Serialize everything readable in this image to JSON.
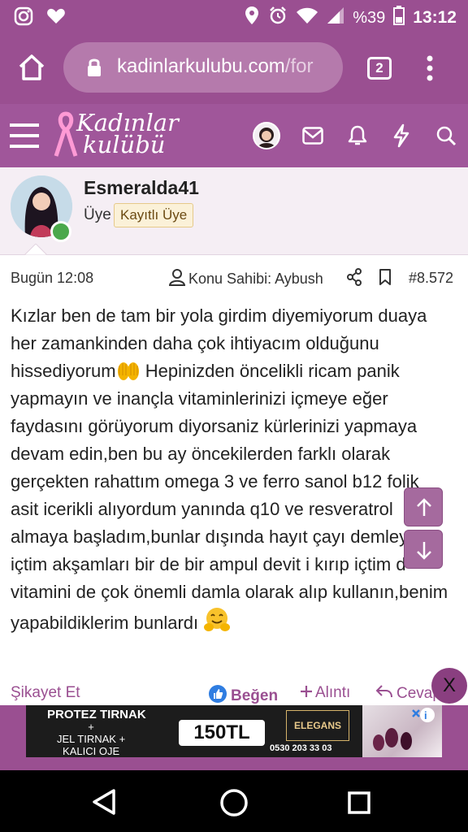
{
  "status_bar": {
    "battery_percent": "%39",
    "time": "13:12",
    "left_icons": [
      "instagram-icon",
      "heart-icon"
    ],
    "right_icons": [
      "location-icon",
      "alarm-icon",
      "wifi-icon",
      "signal-icon",
      "battery-icon"
    ]
  },
  "browser": {
    "url_main": "kadinlarkulubu.com",
    "url_rest": "/for",
    "tab_count": "2"
  },
  "site_header": {
    "logo_line1": "Kadınlar",
    "logo_line2": "kulübü",
    "icons": [
      "menu-icon",
      "avatar",
      "mail-icon",
      "bell-icon",
      "bolt-icon",
      "search-icon"
    ]
  },
  "post_user": {
    "username": "Esmeralda41",
    "role": "Üye",
    "badge": "Kayıtlı Üye"
  },
  "post_meta": {
    "time": "Bugün 12:08",
    "owner": "Konu Sahibi: Aybush",
    "post_number": "#8.572"
  },
  "post_body": {
    "part1": "Kızlar ben de tam bir yola girdim diyemiyorum duaya her zamankinden daha çok ihtiyacım olduğunu hissediyorum",
    "part2": " Hepinizden öncelikli ricam panik yapmayın ve inançla vitaminlerinizi içmeye eğer faydasını görüyorum diyorsaniz kürlerinizi yapmaya devam edin,ben bu ay öncekilerden farklı olarak gerçekten rahattım omega 3 ve ferro sanol b12 folik asit icerikli alıyordum yanında q10 ve resveratrol almaya başladım,bunlar dışında hayıt çayı demleyip içtim akşamları bir de bir ampul devit i kırıp içtim d vitamini de çok önemli damla olarak alıp kullanın,benim yapabildiklerim bunlardı "
  },
  "post_actions": {
    "report": "Şikayet Et",
    "like": "Beğen",
    "quote": "Alıntı",
    "reply": "Cevap"
  },
  "ad": {
    "line1": "PROTEZ TIRNAK",
    "plus": "+",
    "line2": "JEL TIRNAK +",
    "line3": "KALICI OJE",
    "price": "150TL",
    "brand": "ELEGANS",
    "phone": "0530 203 33 03",
    "close": "X"
  },
  "colors": {
    "theme_purple": "#9a4f91",
    "header_purple": "#a0569a",
    "link_purple": "#9a4f91",
    "online_green": "#4aa84b"
  }
}
